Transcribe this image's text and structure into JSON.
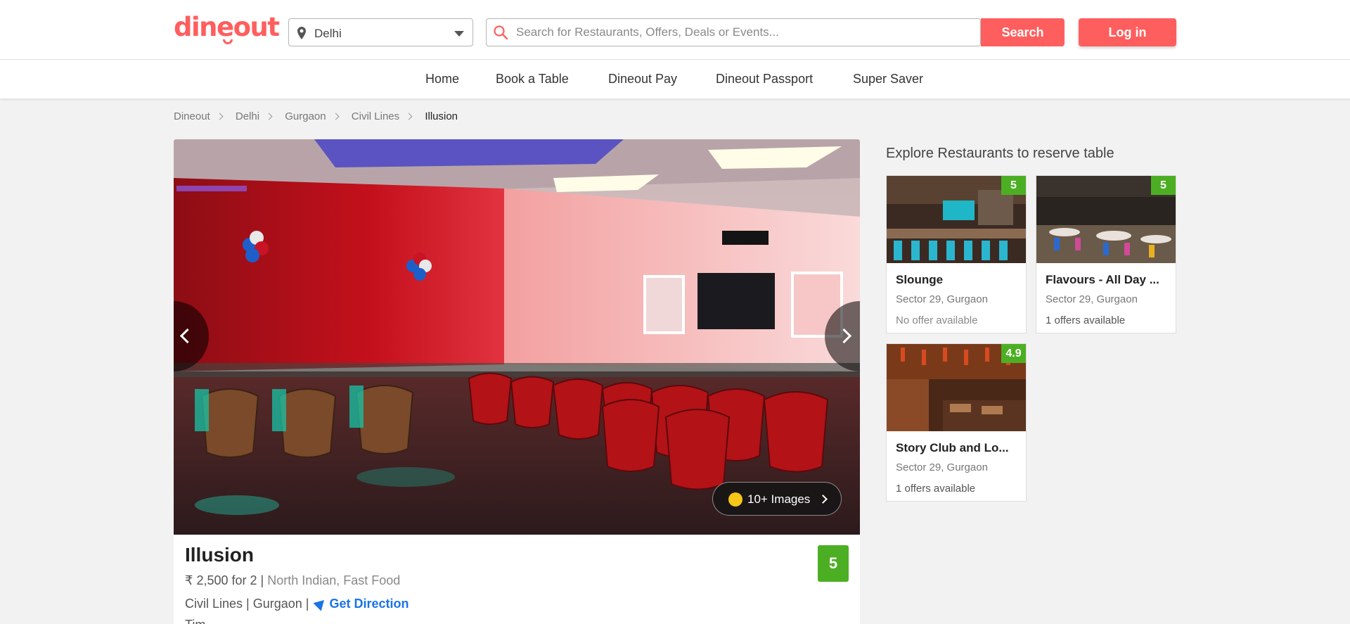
{
  "header": {
    "logo_text": "dineout",
    "city": "Delhi",
    "search_placeholder": "Search for Restaurants, Offers, Deals or Events...",
    "search_button": "Search",
    "login_button": "Log in",
    "brand_color": "#ff5e5e"
  },
  "nav": {
    "items": [
      {
        "label": "Home"
      },
      {
        "label": "Book a Table"
      },
      {
        "label": "Dineout Pay"
      },
      {
        "label": "Dineout Passport"
      },
      {
        "label": "Super Saver"
      }
    ]
  },
  "breadcrumb": [
    "Dineout",
    "Delhi",
    "Gurgaon",
    "Civil Lines",
    "Illusion"
  ],
  "gallery": {
    "images_label": "10+ Images"
  },
  "restaurant": {
    "name": "Illusion",
    "price": "₹ 2,500 for 2",
    "cuisine_1": "North Indian",
    "cuisine_2": "Fast Food",
    "locality": "Civil Lines",
    "city": "Gurgaon",
    "direction_label": "Get Direction",
    "rating": "5",
    "timings_prefix": "Tim"
  },
  "sidebar": {
    "title": "Explore Restaurants to reserve table",
    "cards": [
      {
        "name": "Slounge",
        "location": "Sector 29, Gurgaon",
        "offer": "No offer available",
        "rating": "5"
      },
      {
        "name": "Flavours - All Day ...",
        "location": "Sector 29, Gurgaon",
        "offer": "1 offers available",
        "rating": "5"
      },
      {
        "name": "Story Club and Lo...",
        "location": "Sector 29, Gurgaon",
        "offer": "1 offers available",
        "rating": "4.9"
      }
    ]
  },
  "colors": {
    "accent": "#ff5e5e",
    "rating_green": "#4caf23",
    "link_blue": "#1a73e8"
  }
}
